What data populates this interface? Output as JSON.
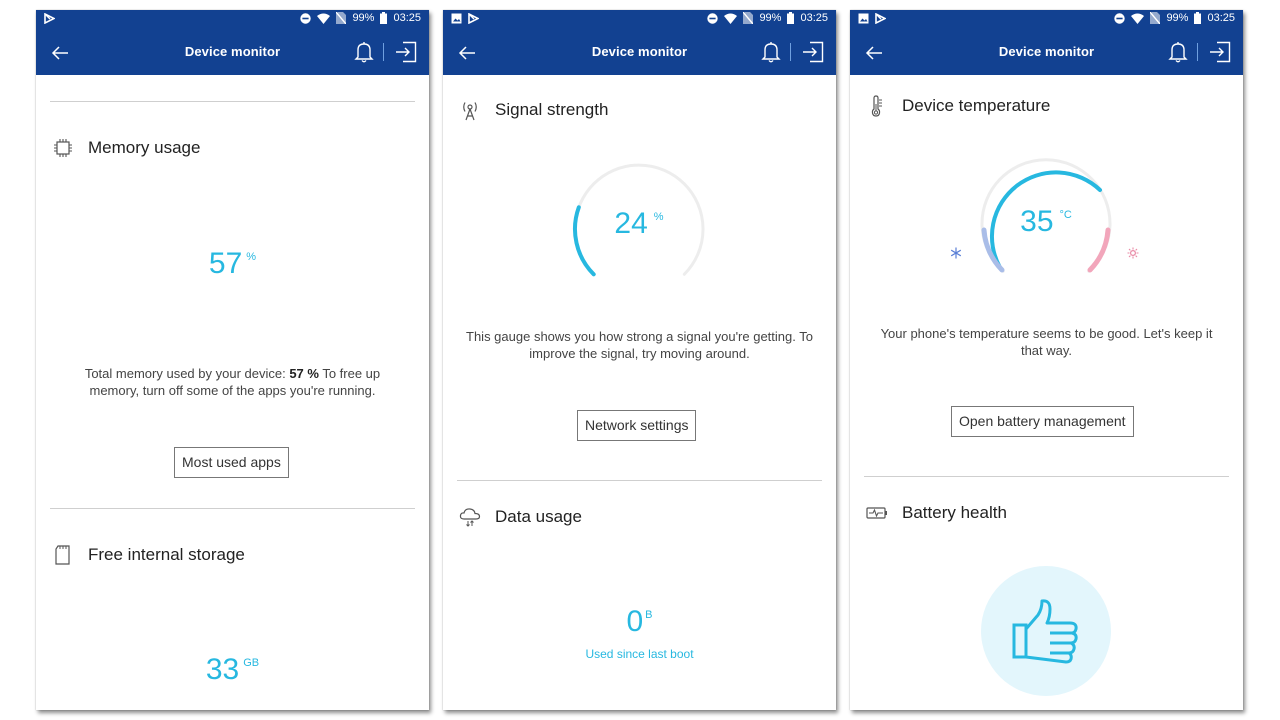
{
  "status_bar": {
    "battery": "99%",
    "time": "03:25"
  },
  "app_bar": {
    "title": "Device monitor"
  },
  "screen1": {
    "memory": {
      "title": "Memory usage",
      "value": "57",
      "unit": "%",
      "desc_prefix": "Total memory used by your device: ",
      "desc_value": "57 %",
      "desc_suffix": " To free up memory, turn off some of the apps you're running.",
      "button": "Most used apps"
    },
    "storage": {
      "title": "Free internal storage",
      "value": "33",
      "unit": "GB"
    }
  },
  "screen2": {
    "signal": {
      "title": "Signal strength",
      "value": "24",
      "unit": "%",
      "gauge_level": 0.24,
      "desc": "This gauge shows you how strong a signal you're getting. To improve the signal, try moving around.",
      "button": "Network settings"
    },
    "data": {
      "title": "Data usage",
      "value": "0",
      "unit": "B",
      "subtext": "Used since last boot"
    }
  },
  "screen3": {
    "temperature": {
      "title": "Device temperature",
      "value": "35",
      "unit": "°C",
      "desc": "Your phone's temperature seems to be good. Let's keep it that way.",
      "button": "Open battery management"
    },
    "battery": {
      "title": "Battery health"
    }
  },
  "colors": {
    "header": "#124191",
    "accent": "#27b8e0",
    "cold": "#a9bde8",
    "hot": "#f2a6bb"
  }
}
